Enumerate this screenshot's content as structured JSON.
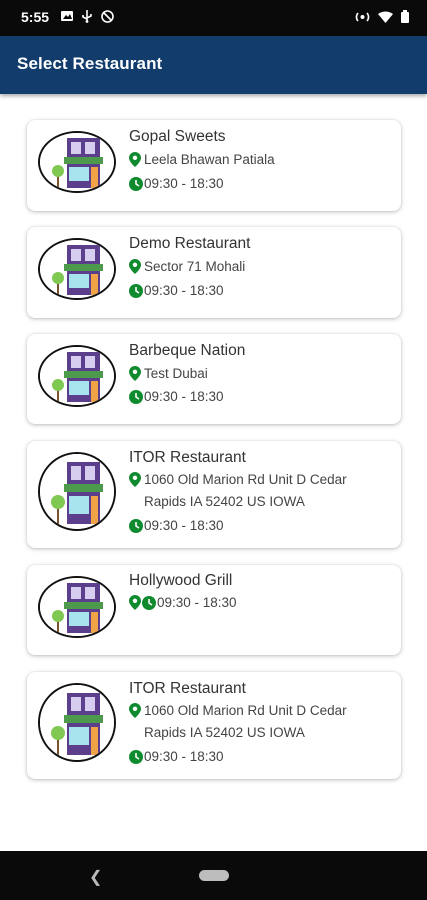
{
  "status_bar": {
    "time": "5:55",
    "left_icons": [
      "image-icon",
      "usb-icon",
      "no-disturb-icon"
    ],
    "right_icons": [
      "hotspot-icon",
      "wifi-icon",
      "battery-icon"
    ]
  },
  "app_bar": {
    "title": "Select Restaurant"
  },
  "colors": {
    "app_bar": "#113c6b",
    "icon_green": "#0f8a2e"
  },
  "restaurants": [
    {
      "name": "Gopal Sweets",
      "address": "Leela Bhawan Patiala",
      "hours": "09:30 - 18:30"
    },
    {
      "name": "Demo Restaurant",
      "address": "Sector 71 Mohali",
      "hours": "09:30 - 18:30"
    },
    {
      "name": "Barbeque Nation",
      "address": "Test Dubai",
      "hours": "09:30 - 18:30"
    },
    {
      "name": "ITOR Restaurant",
      "address": "1060 Old Marion Rd Unit D Cedar Rapids IA 52402 US IOWA",
      "hours": "09:30 - 18:30"
    },
    {
      "name": "Hollywood Grill",
      "address": "",
      "hours": "09:30 - 18:30"
    },
    {
      "name": "ITOR Restaurant",
      "address": "1060 Old Marion Rd Unit D Cedar Rapids IA 52402 US IOWA",
      "hours": "09:30 - 18:30"
    }
  ],
  "nav_bar": {
    "buttons": [
      "back-icon",
      "home-icon"
    ]
  }
}
